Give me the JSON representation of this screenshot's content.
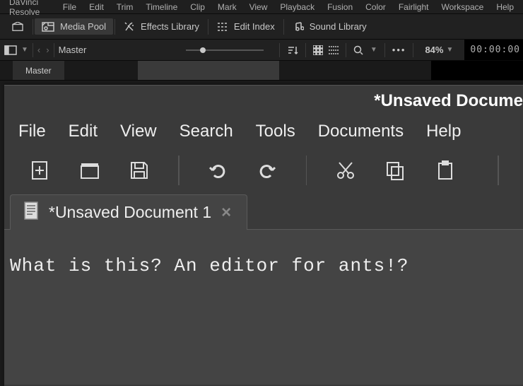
{
  "davinci": {
    "menubar": [
      "DaVinci Resolve",
      "File",
      "Edit",
      "Trim",
      "Timeline",
      "Clip",
      "Mark",
      "View",
      "Playback",
      "Fusion",
      "Color",
      "Fairlight",
      "Workspace",
      "Help"
    ],
    "shelf": {
      "media_pool": "Media Pool",
      "effects_library": "Effects Library",
      "edit_index": "Edit Index",
      "sound_library": "Sound Library"
    },
    "toolbar2": {
      "breadcrumb": "Master",
      "zoom": "84%",
      "timecode": "00:00:00"
    },
    "tab": "Master"
  },
  "editor": {
    "window_title": "*Unsaved Docume",
    "menubar": [
      "File",
      "Edit",
      "View",
      "Search",
      "Tools",
      "Documents",
      "Help"
    ],
    "tab": {
      "label": "*Unsaved Document 1"
    },
    "body_text": "What is this? An editor for ants!?"
  }
}
